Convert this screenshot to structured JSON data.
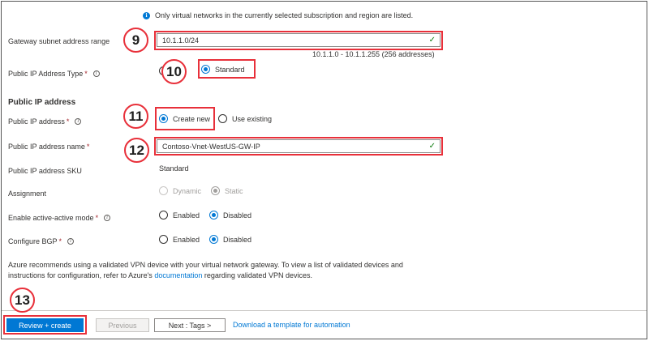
{
  "info_banner": {
    "text": "Only virtual networks in the currently selected subscription and region are listed."
  },
  "gateway_subnet": {
    "label": "Gateway subnet address range",
    "value": "10.1.1.0/24",
    "range_hint": "10.1.1.0 - 10.1.1.255 (256 addresses)"
  },
  "public_ip_type": {
    "label": "Public IP Address Type",
    "required": "*",
    "options": [
      "Basic",
      "Standard"
    ],
    "basic_visible_text": "ic",
    "selected": "Standard"
  },
  "public_ip_section": {
    "title": "Public IP address"
  },
  "public_ip_address": {
    "label": "Public IP address",
    "required": "*",
    "options": [
      "Create new",
      "Use existing"
    ],
    "selected": "Create new"
  },
  "public_ip_name": {
    "label": "Public IP address name",
    "required": "*",
    "value": "Contoso-Vnet-WestUS-GW-IP"
  },
  "public_ip_sku": {
    "label": "Public IP address SKU",
    "value": "Standard"
  },
  "assignment": {
    "label": "Assignment",
    "options": [
      "Dynamic",
      "Static"
    ],
    "selected": "Static",
    "disabled": true
  },
  "active_active": {
    "label": "Enable active-active mode",
    "required": "*",
    "options": [
      "Enabled",
      "Disabled"
    ],
    "selected": "Disabled"
  },
  "bgp": {
    "label": "Configure BGP",
    "required": "*",
    "options": [
      "Enabled",
      "Disabled"
    ],
    "selected": "Disabled"
  },
  "recommendation": {
    "line1": "Azure recommends using a validated VPN device with your virtual network gateway. To view a list of validated devices and",
    "line2_prefix": "instructions for configuration, refer to Azure's",
    "line2_link": "documentation",
    "line2_suffix": "regarding validated VPN devices."
  },
  "footer": {
    "review_create": "Review + create",
    "previous": "Previous",
    "next": "Next : Tags >",
    "download_template": "Download a template for automation"
  },
  "annotations": [
    "9",
    "10",
    "11",
    "12",
    "13"
  ],
  "colors": {
    "accent": "#0078d4",
    "callout": "#e8303a",
    "valid": "#107c10",
    "required": "#a4262c"
  }
}
